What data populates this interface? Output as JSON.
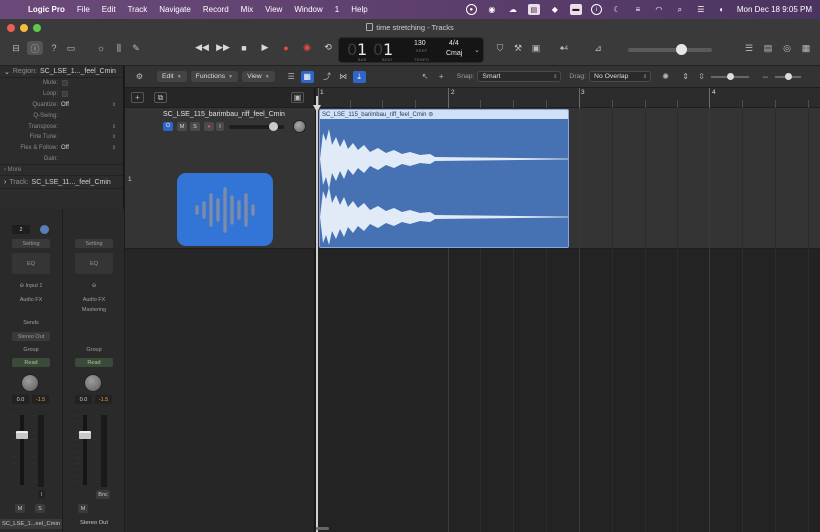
{
  "menubar": {
    "menus": [
      "Logic Pro",
      "File",
      "Edit",
      "Track",
      "Navigate",
      "Record",
      "Mix",
      "View",
      "Window",
      "1",
      "Help"
    ],
    "datetime": "Mon Dec 18  9:05 PM"
  },
  "window": {
    "title": "time stretching - Tracks"
  },
  "lcd": {
    "bar": "1",
    "beat": "1",
    "bar_label": "BAR",
    "beat_label": "BEAT",
    "tempo": "130",
    "tempo_label": "TEMPO",
    "keep_label": "KEEP",
    "signature": "4/4",
    "key": "Cmaj"
  },
  "toolbar": {
    "midi_label": "♣4"
  },
  "inspector": {
    "region_label": "Region:",
    "region_name": "SC_LSE_1..._feel_Cmin",
    "rows": [
      {
        "key": "Mute:",
        "value": ""
      },
      {
        "key": "Loop:",
        "value": ""
      },
      {
        "key": "Quantize:",
        "value": "Off"
      },
      {
        "key": "Q-Swing:",
        "value": ""
      },
      {
        "key": "Transpose:",
        "value": ""
      },
      {
        "key": "Fine Tune:",
        "value": ""
      },
      {
        "key": "Flex & Follow:",
        "value": "Off"
      },
      {
        "key": "Gain:",
        "value": ""
      }
    ],
    "more_label": "More",
    "track_label": "Track:",
    "track_name": "SC_LSE_11..._feel_Cmin"
  },
  "strips": [
    {
      "channel": "2",
      "setting": "Setting",
      "eq": "EQ",
      "input": "Input 1",
      "audio_fx": "Audio FX",
      "sends": "Sends",
      "output": "Stereo Out",
      "group": "Group",
      "automation": "Read",
      "volume": "0.0",
      "peak": "-1.5",
      "mute": "M",
      "solo": "S",
      "name": "SC_LSE_1...eel_Cmin"
    },
    {
      "setting": "Setting",
      "eq": "EQ",
      "audio_fx": "Audio FX",
      "mastering": "Mastering",
      "group": "Group",
      "automation": "Read",
      "volume": "0.0",
      "peak": "-1.5",
      "bounce": "Bnc",
      "mute": "M",
      "name": "Stereo Out"
    }
  ],
  "tracks_menubar": {
    "edit": "Edit",
    "functions": "Functions",
    "view": "View",
    "snap_label": "Snap:",
    "snap_value": "Smart",
    "drag_label": "Drag:",
    "drag_value": "No Overlap"
  },
  "track": {
    "number": "1",
    "name": "SC_LSE_115_barimbau_riff_feel_Cmin",
    "mute": "M",
    "solo": "S",
    "input": "I"
  },
  "ruler": {
    "bars": [
      "1",
      "2",
      "3",
      "4"
    ]
  },
  "region": {
    "name": "SC_LSE_115_barimbau_riff_feel_Cmin"
  },
  "colors": {
    "region_fill": "#4672b4",
    "region_header": "#cfe0f7",
    "accent_blue": "#2f66c9",
    "record_red": "#e84a3f",
    "menubar": "#5b3d6b"
  }
}
